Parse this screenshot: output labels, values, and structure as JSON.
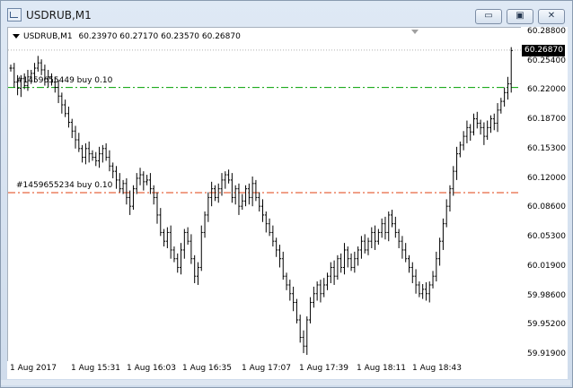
{
  "window": {
    "title": "USDRUB,M1",
    "minimize_glyph": "▭",
    "maximize_glyph": "▣",
    "close_glyph": "✕"
  },
  "symbol_info": {
    "symbol": "USDRUB,M1",
    "ohlc": "60.23970 60.27170 60.23570 60.26870"
  },
  "orders": [
    {
      "label": "#1459655449 buy 0.10",
      "price": 60.2259,
      "color": "#00a000"
    },
    {
      "label": "#1459655234 buy 0.10",
      "price": 60.1055,
      "color": "#e04010"
    }
  ],
  "current_price": "60.26870",
  "chart_data": {
    "type": "candlestick",
    "y_ticks": [
      "60.28800",
      "60.25400",
      "60.22000",
      "60.18700",
      "60.15300",
      "60.12000",
      "60.08600",
      "60.05300",
      "60.01900",
      "59.98600",
      "59.95200",
      "59.91900"
    ],
    "x_ticks": [
      "1 Aug 2017",
      "1 Aug 15:31",
      "1 Aug 16:03",
      "1 Aug 16:35",
      "1 Aug 17:07",
      "1 Aug 17:39",
      "1 Aug 18:11",
      "1 Aug 18:43"
    ],
    "ylim": [
      59.919,
      60.288
    ],
    "closes": [
      60.248,
      60.232,
      60.225,
      60.236,
      60.228,
      60.238,
      60.242,
      60.248,
      60.254,
      60.246,
      60.236,
      60.238,
      60.232,
      60.226,
      60.216,
      60.206,
      60.196,
      60.186,
      60.176,
      60.166,
      60.156,
      60.146,
      60.156,
      60.15,
      60.146,
      60.142,
      60.15,
      60.156,
      60.146,
      60.136,
      60.13,
      60.12,
      60.11,
      60.116,
      60.1,
      60.09,
      60.11,
      60.122,
      60.126,
      60.118,
      60.12,
      60.11,
      60.1,
      60.08,
      60.06,
      60.05,
      60.06,
      60.04,
      60.03,
      60.02,
      60.04,
      60.06,
      60.05,
      60.03,
      60.01,
      60.02,
      60.06,
      60.08,
      60.1,
      60.11,
      60.1,
      60.11,
      60.12,
      60.126,
      60.12,
      60.1,
      60.11,
      60.09,
      60.096,
      60.11,
      60.1,
      60.116,
      60.1,
      60.09,
      60.08,
      60.07,
      60.06,
      60.05,
      60.04,
      60.03,
      60.01,
      60.0,
      59.99,
      59.98,
      59.96,
      59.94,
      59.93,
      59.96,
      59.98,
      59.99,
      60.0,
      59.99,
      60.0,
      60.01,
      60.02,
      60.01,
      60.03,
      60.02,
      60.04,
      60.03,
      60.02,
      60.03,
      60.04,
      60.05,
      60.04,
      60.05,
      60.06,
      60.05,
      60.06,
      60.07,
      60.06,
      60.08,
      60.07,
      60.06,
      60.05,
      60.04,
      60.03,
      60.02,
      60.01,
      60.0,
      59.99,
      59.995,
      59.99,
      60.0,
      60.01,
      60.03,
      60.05,
      60.07,
      60.09,
      60.11,
      60.13,
      60.15,
      60.16,
      60.17,
      60.18,
      60.175,
      60.19,
      60.185,
      60.18,
      60.17,
      60.18,
      60.19,
      60.185,
      60.2,
      60.21,
      60.22,
      60.23,
      60.268
    ]
  }
}
